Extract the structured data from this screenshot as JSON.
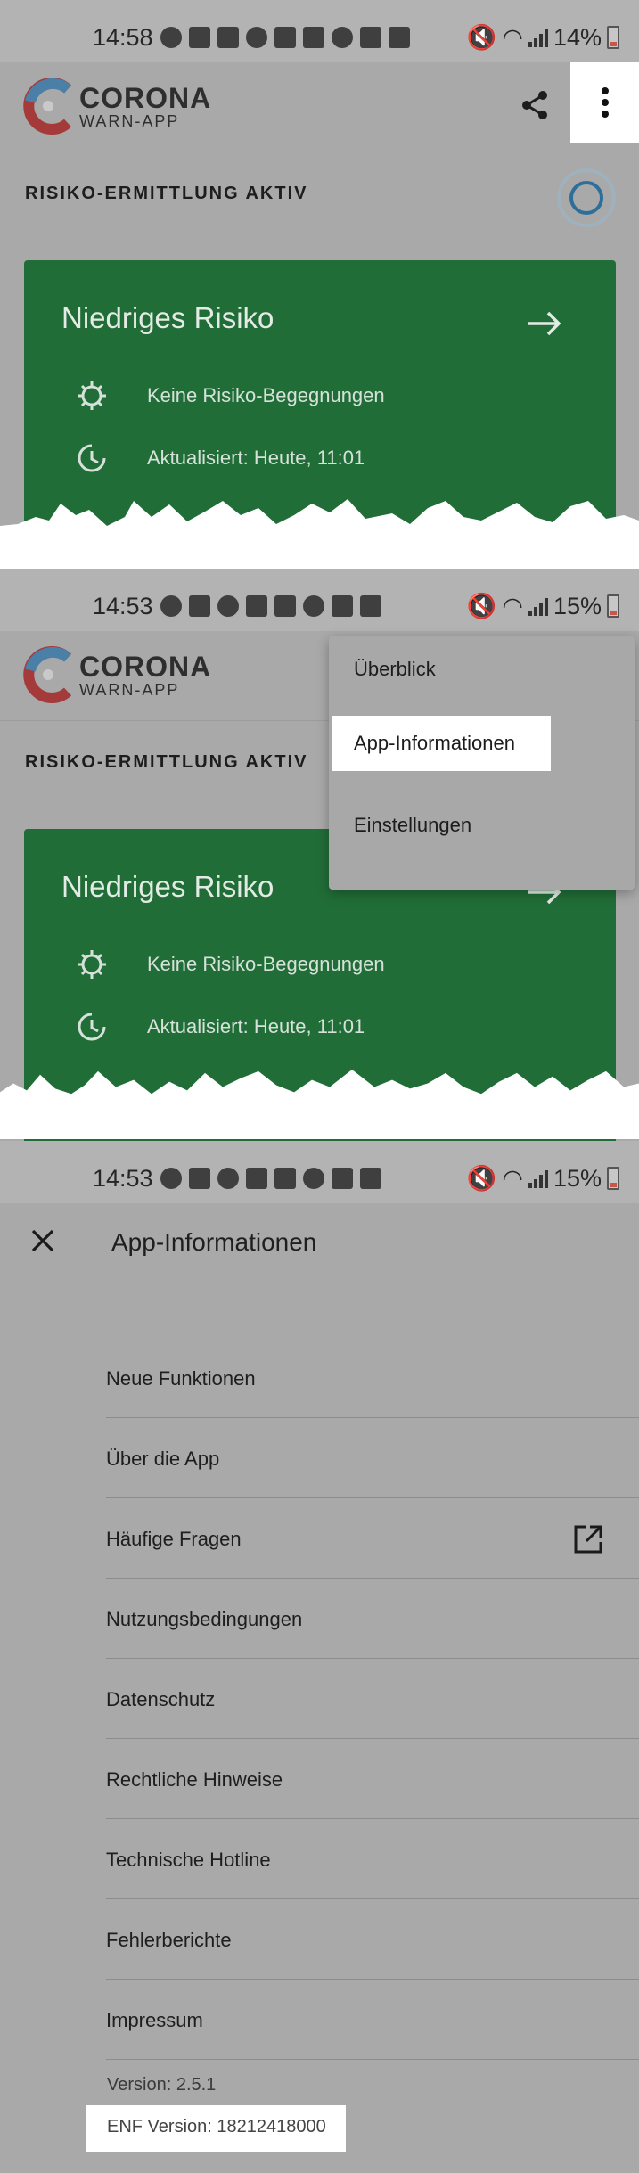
{
  "panels": [
    {
      "status": {
        "time": "14:58",
        "battery": "14%"
      },
      "app_name_line1": "CORONA",
      "app_name_line2": "WARN-APP",
      "risk_status": "RISIKO-ERMITTLUNG AKTIV",
      "card": {
        "title": "Niedriges Risiko",
        "encounters": "Keine Risiko-Begegnungen",
        "updated": "Aktualisiert: Heute, 11:01",
        "color": "#216d38"
      }
    },
    {
      "status": {
        "time": "14:53",
        "battery": "15%"
      },
      "app_name_line1": "CORONA",
      "app_name_line2": "WARN-APP",
      "risk_status": "RISIKO-ERMITTLUNG AKTIV",
      "card": {
        "title": "Niedriges Risiko",
        "encounters": "Keine Risiko-Begegnungen",
        "updated": "Aktualisiert: Heute, 11:01"
      },
      "menu": [
        "Überblick",
        "App-Informationen",
        "Einstellungen"
      ],
      "menu_highlighted": "App-Informationen"
    },
    {
      "status": {
        "time": "14:53",
        "battery": "15%"
      },
      "title": "App-Informationen",
      "items": [
        "Neue Funktionen",
        "Über die App",
        "Häufige Fragen",
        "Nutzungsbedingungen",
        "Datenschutz",
        "Rechtliche Hinweise",
        "Technische Hotline",
        "Fehlerberichte",
        "Impressum"
      ],
      "external_link_item": "Häufige Fragen",
      "version": "Version: 2.5.1",
      "enf_version": "ENF Version: 18212418000"
    }
  ],
  "icons": [
    "share-icon",
    "more-vert-icon",
    "virus-icon",
    "clock-icon",
    "arrow-right-icon",
    "close-icon",
    "external-link-icon"
  ],
  "colors": {
    "card_green": "#216d38",
    "ring_blue": "#2d6f99",
    "overlay_gray": "#a9a9a9",
    "highlight": "#ffffff"
  }
}
